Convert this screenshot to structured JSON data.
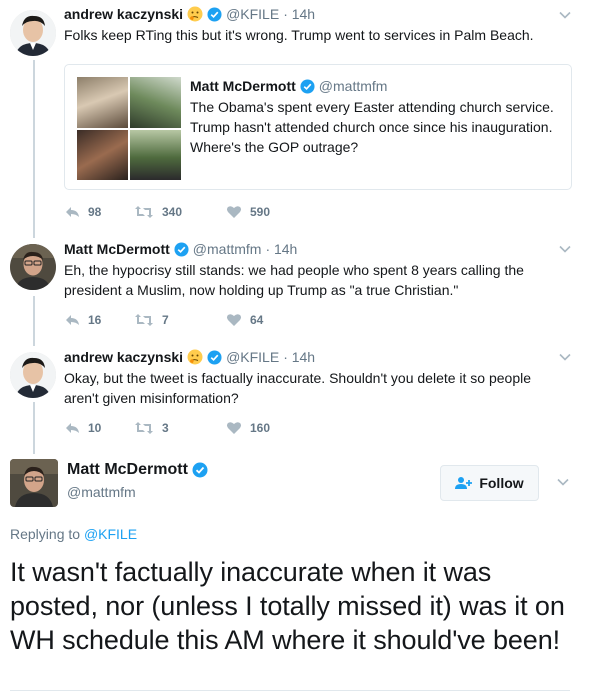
{
  "tweets": [
    {
      "name": "andrew kaczynski",
      "handle": "@KFILE",
      "time": "· 14h",
      "text": "Folks keep RTing this but it's wrong. Trump went to services in Palm Beach.",
      "replies": "98",
      "retweets": "340",
      "likes": "590",
      "quoted": {
        "name": "Matt McDermott",
        "handle": "@mattmfm",
        "text": "The Obama's spent every Easter attending church service. Trump hasn't attended church once since his inauguration. Where's the GOP outrage?"
      }
    },
    {
      "name": "Matt McDermott",
      "handle": "@mattmfm",
      "time": "· 14h",
      "text": "Eh, the hypocrisy still stands: we had people who spent 8 years calling the president a Muslim, now holding up Trump as \"a true Christian.\"",
      "replies": "16",
      "retweets": "7",
      "likes": "64"
    },
    {
      "name": "andrew kaczynski",
      "handle": "@KFILE",
      "time": "· 14h",
      "text": "Okay, but the tweet is factually inaccurate. Shouldn't you delete it so people aren't given misinformation?",
      "replies": "10",
      "retweets": "3",
      "likes": "160"
    }
  ],
  "focused": {
    "name": "Matt McDermott",
    "handle": "@mattmfm",
    "follow_label": "Follow",
    "replying_prefix": "Replying to",
    "replying_to": "@KFILE",
    "text": "It wasn't factually inaccurate when it was posted, nor (unless I totally missed it) was it on WH schedule this AM where it should've been!"
  },
  "colors": {
    "verified": "#1da1f2",
    "link": "#1da1f2",
    "muted": "#657786",
    "action_icon": "#aab8c2"
  }
}
